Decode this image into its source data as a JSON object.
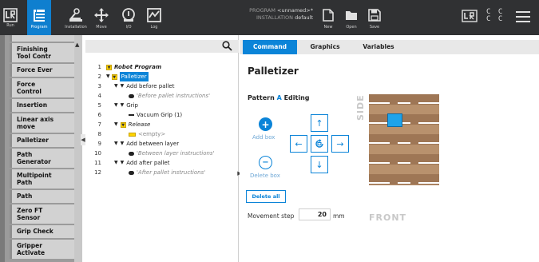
{
  "topbar": {
    "buttons": [
      {
        "label": "Run",
        "icon": "ur-logo-icon"
      },
      {
        "label": "Program",
        "icon": "program-icon",
        "active": true
      },
      {
        "label": "Installation",
        "icon": "installation-icon"
      },
      {
        "label": "Move",
        "icon": "move-icon"
      },
      {
        "label": "I/O",
        "icon": "io-icon"
      },
      {
        "label": "Log",
        "icon": "log-icon"
      }
    ],
    "program_label": "PROGRAM",
    "program_value": "<unnamed>*",
    "installation_label": "INSTALLATION",
    "installation_value": "default",
    "file_buttons": [
      {
        "label": "New",
        "icon": "new-file-icon"
      },
      {
        "label": "Open",
        "icon": "open-folder-icon"
      },
      {
        "label": "Save",
        "icon": "save-icon"
      }
    ],
    "cc_text": "C C\nC C"
  },
  "sidebar": {
    "partial_top": "",
    "items": [
      {
        "label": "Finishing\nTool Contr"
      },
      {
        "label": "Force Ever"
      },
      {
        "label": "Force\nControl"
      },
      {
        "label": "Insertion"
      },
      {
        "label": "Linear axis\nmove"
      },
      {
        "label": "Palletizer"
      },
      {
        "label": "Path\nGenerator"
      },
      {
        "label": "Multipoint\nPath"
      },
      {
        "label": "Path"
      },
      {
        "label": "Zero FT\nSensor"
      },
      {
        "label": "Grip Check"
      },
      {
        "label": "Gripper\nActivate"
      }
    ]
  },
  "tree": {
    "rows": [
      {
        "num": "1",
        "text": "Robot Program"
      },
      {
        "num": "2",
        "text": "Palletizer"
      },
      {
        "num": "3",
        "text": "Add before pallet"
      },
      {
        "num": "4",
        "text": "'Before pallet instructions'"
      },
      {
        "num": "5",
        "text": "Grip"
      },
      {
        "num": "6",
        "text": "Vacuum Grip  (1)"
      },
      {
        "num": "7",
        "text": "Release"
      },
      {
        "num": "8",
        "text": "<empty>"
      },
      {
        "num": "9",
        "text": "Add between layer"
      },
      {
        "num": "10",
        "text": "'Between layer instructions'"
      },
      {
        "num": "11",
        "text": "Add after pallet"
      },
      {
        "num": "12",
        "text": "'After pallet instructions'"
      }
    ]
  },
  "main": {
    "tabs": [
      "Command",
      "Graphics",
      "Variables"
    ],
    "title": "Palletizer",
    "pattern_prefix": "Pattern",
    "pattern_letter": "A",
    "pattern_suffix": "Editing",
    "add_box_label": "Add box",
    "delete_box_label": "Delete box",
    "delete_all_label": "Delete all",
    "movement_step_label": "Movement step",
    "movement_step_value": "20",
    "movement_step_unit": "mm",
    "side_label": "SIDE",
    "front_label": "FRONT"
  },
  "colors": {
    "topbar": "#303133",
    "accent": "#0b84d8",
    "pallet_wood": "#b8916d",
    "box_blue": "#1ea3ea",
    "highlight_yellow": "#ffd400"
  }
}
